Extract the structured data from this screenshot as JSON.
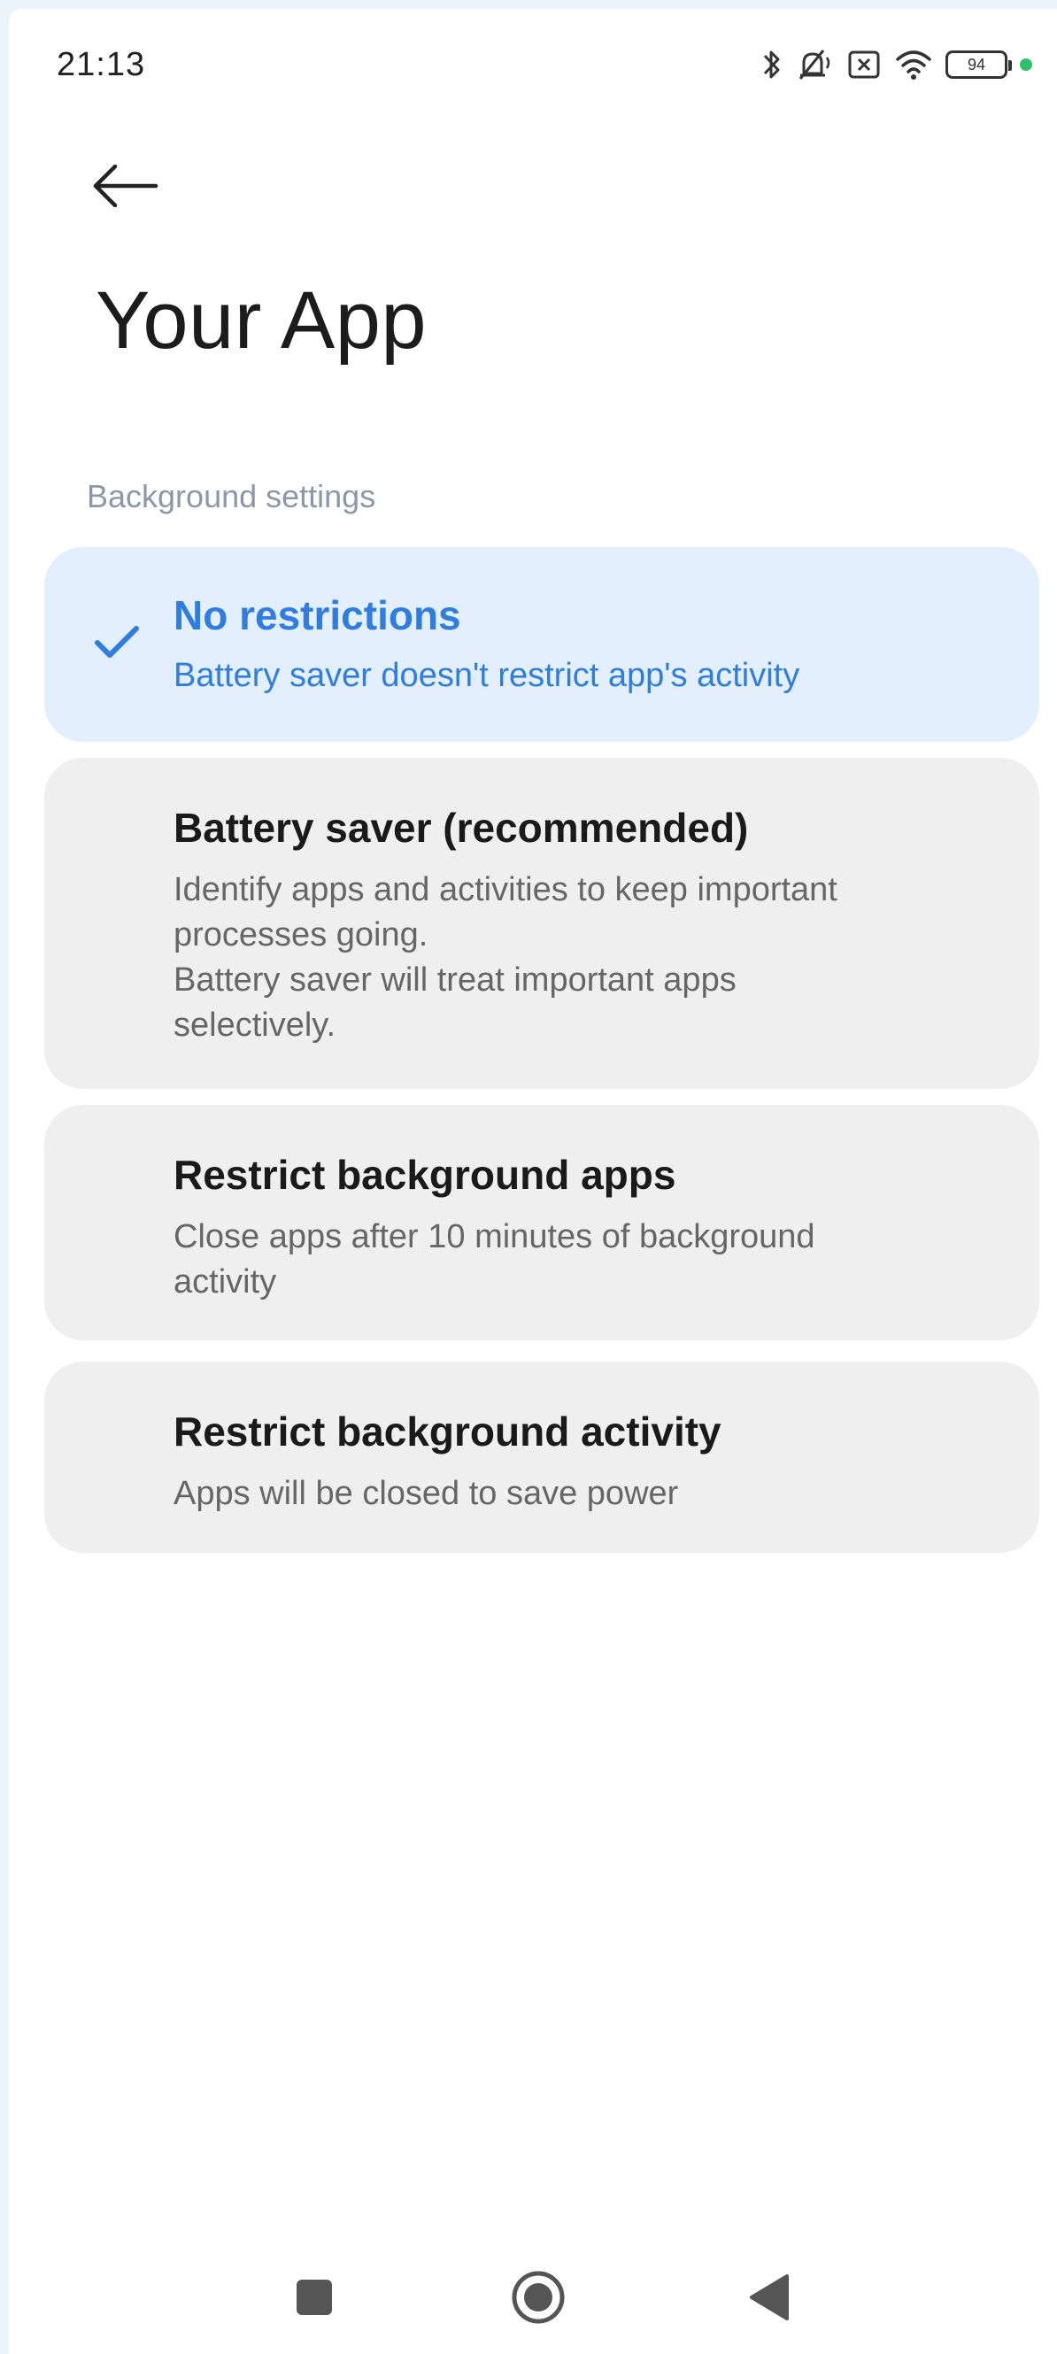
{
  "status_bar": {
    "time": "21:13",
    "battery_level": "94",
    "icons": [
      "bluetooth-icon",
      "muted-icon",
      "sim-x-icon",
      "wifi-icon",
      "battery-icon",
      "green-dot"
    ]
  },
  "header": {
    "back_icon": "arrow-left-icon",
    "title": "Your App"
  },
  "section": {
    "label": "Background settings"
  },
  "options": [
    {
      "title": "No restrictions",
      "description": "Battery saver doesn't restrict app's activity",
      "selected": true
    },
    {
      "title": "Battery saver (recommended)",
      "description": "Identify apps and activities to keep important\nprocesses going.\nBattery saver will treat important apps\nselectively.",
      "selected": false
    },
    {
      "title": "Restrict background apps",
      "description": "Close apps after 10 minutes of background\nactivity",
      "selected": false
    },
    {
      "title": "Restrict background activity",
      "description": "Apps will be closed to save power",
      "selected": false
    }
  ],
  "nav_bar": {
    "icons": [
      "recents-square-icon",
      "home-circle-icon",
      "back-triangle-icon"
    ]
  },
  "colors": {
    "accent": "#2f7de1",
    "selected_bg": "#e3effd",
    "card_bg": "#efefef",
    "page_bg": "#ffffff",
    "frame_bg": "#eaf3fa",
    "status_dot": "#2ec06b"
  }
}
